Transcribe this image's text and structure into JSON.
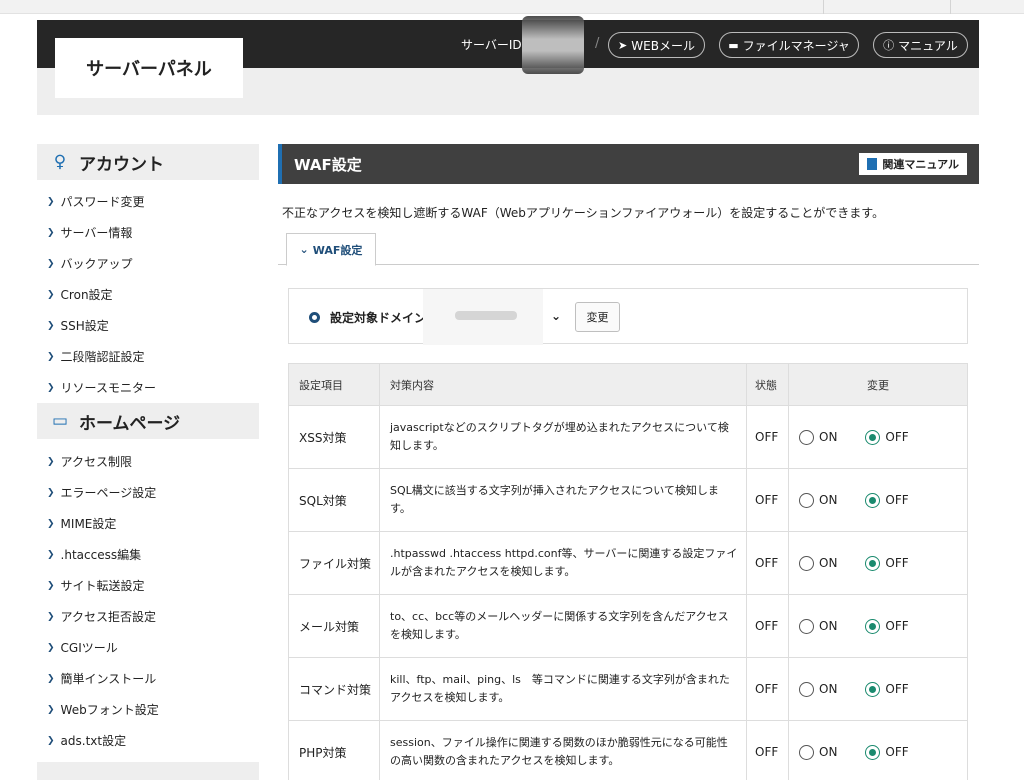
{
  "header": {
    "logo": "サーバーパネル",
    "server_id_label": "サーバーID",
    "slash": "/",
    "webmail": "WEBメール",
    "file_manager": "ファイルマネージャ",
    "manual": "マニュアル",
    "webmail_icon": "paper-plane-icon",
    "file_manager_icon": "folder-icon",
    "manual_icon": "question-circle-icon"
  },
  "sidebar": {
    "sections": [
      {
        "title": "アカウント",
        "icon": "user-icon",
        "items": [
          "パスワード変更",
          "サーバー情報",
          "バックアップ",
          "Cron設定",
          "SSH設定",
          "二段階認証設定",
          "リソースモニター"
        ]
      },
      {
        "title": "ホームページ",
        "icon": "browser-window-icon",
        "items": [
          "アクセス制限",
          "エラーページ設定",
          "MIME設定",
          ".htaccess編集",
          "サイト転送設定",
          "アクセス拒否設定",
          "CGIツール",
          "簡単インストール",
          "Webフォント設定",
          "ads.txt設定"
        ]
      }
    ]
  },
  "main": {
    "title": "WAF設定",
    "manual_button": "関連マニュアル",
    "description": "不正なアクセスを検知し遮断するWAF（Webアプリケーションファイアウォール）を設定することができます。",
    "tab": "WAF設定",
    "domain_label": "設定対象ドメイン",
    "change_button": "変更",
    "accent_color": "#1f6fb2"
  },
  "table": {
    "headers": [
      "設定項目",
      "対策内容",
      "状態",
      "変更"
    ],
    "on_label": "ON",
    "off_label": "OFF",
    "rows": [
      {
        "item": "XSS対策",
        "desc": "javascriptなどのスクリプトタグが埋め込まれたアクセスについて検知します。",
        "status": "OFF",
        "selected": "OFF"
      },
      {
        "item": "SQL対策",
        "desc": "SQL構文に該当する文字列が挿入されたアクセスについて検知します。",
        "status": "OFF",
        "selected": "OFF"
      },
      {
        "item": "ファイル対策",
        "desc": ".htpasswd .htaccess httpd.conf等、サーバーに関連する設定ファイルが含まれたアクセスを検知します。",
        "status": "OFF",
        "selected": "OFF"
      },
      {
        "item": "メール対策",
        "desc": "to、cc、bcc等のメールヘッダーに関係する文字列を含んだアクセスを検知します。",
        "status": "OFF",
        "selected": "OFF"
      },
      {
        "item": "コマンド対策",
        "desc": "kill、ftp、mail、ping、ls　等コマンドに関連する文字列が含まれたアクセスを検知します。",
        "status": "OFF",
        "selected": "OFF"
      },
      {
        "item": "PHP対策",
        "desc": "session、ファイル操作に関連する関数のほか脆弱性元になる可能性の高い関数の含まれたアクセスを検知します。",
        "status": "OFF",
        "selected": "OFF"
      }
    ]
  }
}
